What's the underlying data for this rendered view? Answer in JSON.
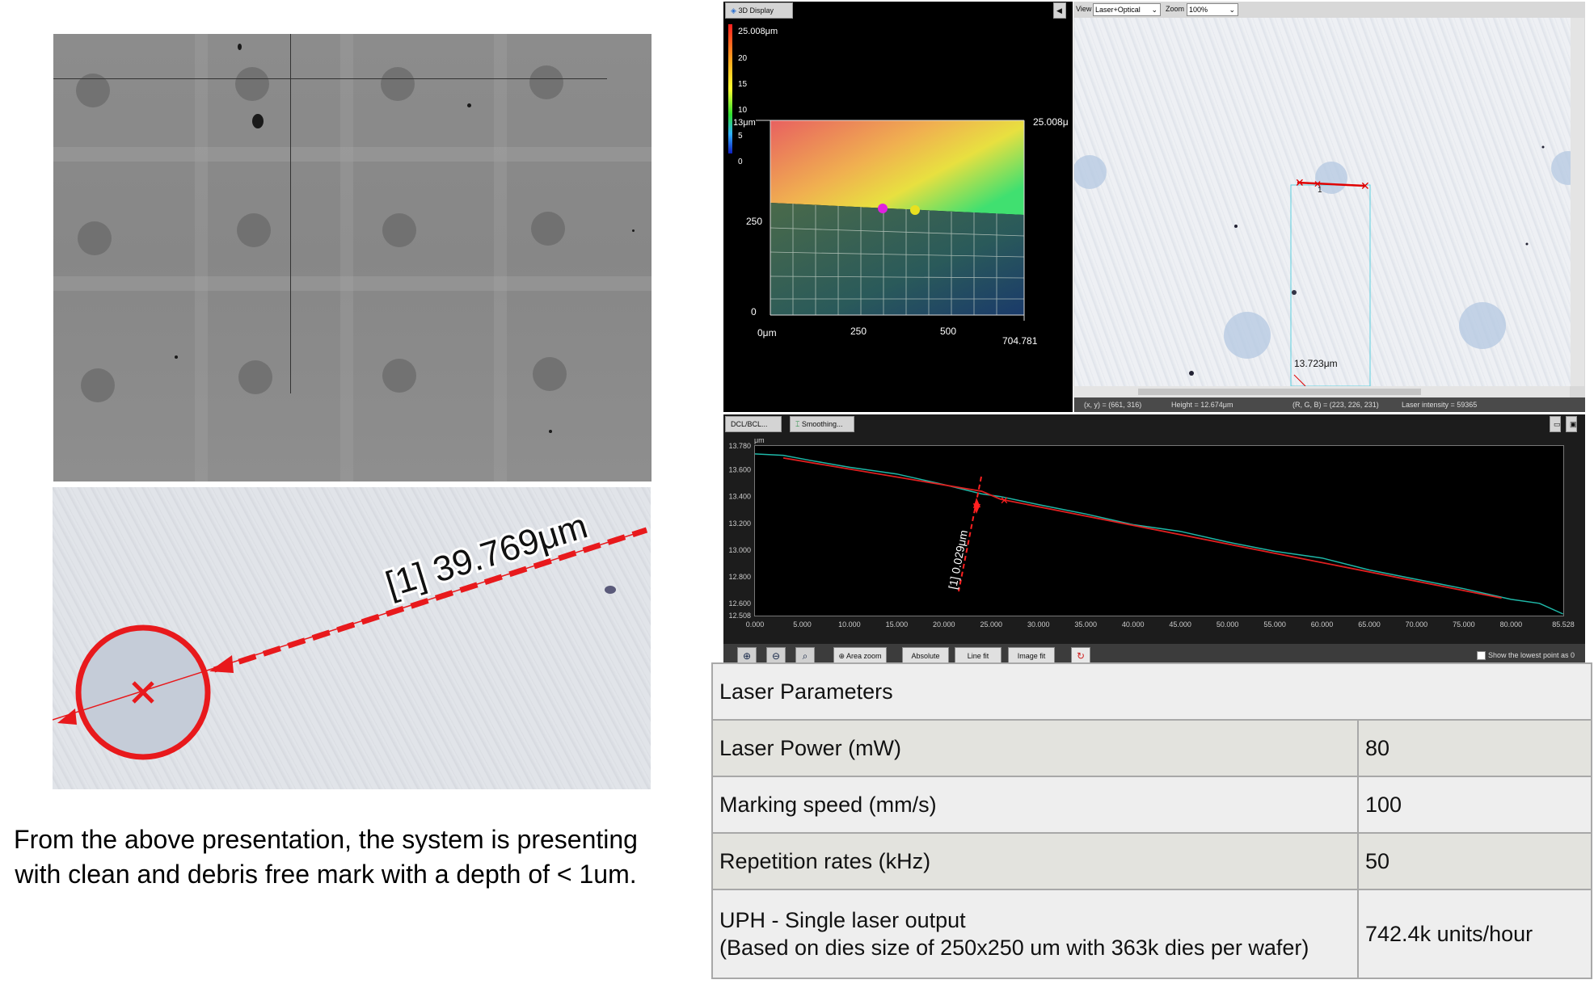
{
  "measurement_label": "[1] 39.769μm",
  "conclusion": "From the above presentation, the system is presenting with clean and debris free mark with a depth of < 1um.",
  "display3d": {
    "tab_label": "3D Display",
    "max_height_label": "25.008μm",
    "scale_ticks": [
      "20",
      "15",
      "10",
      "5",
      "0"
    ],
    "z_top_label": "13μm",
    "z_right_label": "25.008μ",
    "y_ticks": [
      "250",
      "0"
    ],
    "x_ticks": [
      "0μm",
      "250",
      "500",
      "704.781"
    ]
  },
  "optical": {
    "view_label": "View",
    "view_mode": "Laser+Optical",
    "zoom_label": "Zoom",
    "zoom_value": "100%",
    "point_label": "1",
    "width_label": "13.723μm",
    "status": {
      "xy": "(x, y)  =  (661, 316)",
      "height": "Height  =  12.674μm",
      "rgb": "(R, G, B)  =  (223, 226, 231)",
      "intensity": "Laser intensity  =  59365"
    }
  },
  "profile": {
    "tabs": [
      "DCL/BCL...",
      "Smoothing..."
    ],
    "unit": "μm",
    "measure_label": "[1] 0.029μm",
    "toolbar": {
      "area_zoom": "Area zoom",
      "absolute": "Absolute",
      "line_fit": "Line fit",
      "image_fit": "Image fit",
      "lowest_point": "Show the lowest point as 0"
    }
  },
  "chart_data": {
    "type": "line",
    "xlabel": "",
    "ylabel": "μm",
    "xlim": [
      0,
      85.528
    ],
    "ylim": [
      12.508,
      13.78
    ],
    "x_ticks": [
      "0.000",
      "5.000",
      "10.000",
      "15.000",
      "20.000",
      "25.000",
      "30.000",
      "35.000",
      "40.000",
      "45.000",
      "50.000",
      "55.000",
      "60.000",
      "65.000",
      "70.000",
      "75.000",
      "80.000",
      "85.528"
    ],
    "y_ticks": [
      "13.780",
      "13.600",
      "13.400",
      "13.200",
      "13.000",
      "12.800",
      "12.600",
      "12.508"
    ],
    "series": [
      {
        "color": "#1fb8a8",
        "x": [
          0,
          3,
          6,
          10,
          15,
          20,
          24,
          26,
          30,
          35,
          40,
          45,
          50,
          55,
          60,
          65,
          70,
          75,
          80,
          83,
          85.5
        ],
        "y": [
          13.72,
          13.71,
          13.67,
          13.62,
          13.57,
          13.49,
          13.42,
          13.4,
          13.34,
          13.27,
          13.19,
          13.14,
          13.06,
          12.99,
          12.94,
          12.85,
          12.78,
          12.71,
          12.63,
          12.6,
          12.52
        ]
      },
      {
        "color": "#e02020",
        "x": [
          3,
          24,
          26,
          79
        ],
        "y": [
          13.69,
          13.44,
          13.38,
          12.64
        ]
      }
    ]
  },
  "parameters": {
    "header": "Laser Parameters",
    "rows": [
      {
        "name": "Laser Power (mW)",
        "value": "80"
      },
      {
        "name": "Marking speed (mm/s)",
        "value": "100"
      },
      {
        "name": "Repetition rates (kHz)",
        "value": "50"
      }
    ],
    "uph": {
      "name_line1": "UPH - Single laser output",
      "name_line2": "(Based on dies size of 250x250 um with 363k dies per wafer)",
      "value": "742.4k units/hour"
    }
  }
}
